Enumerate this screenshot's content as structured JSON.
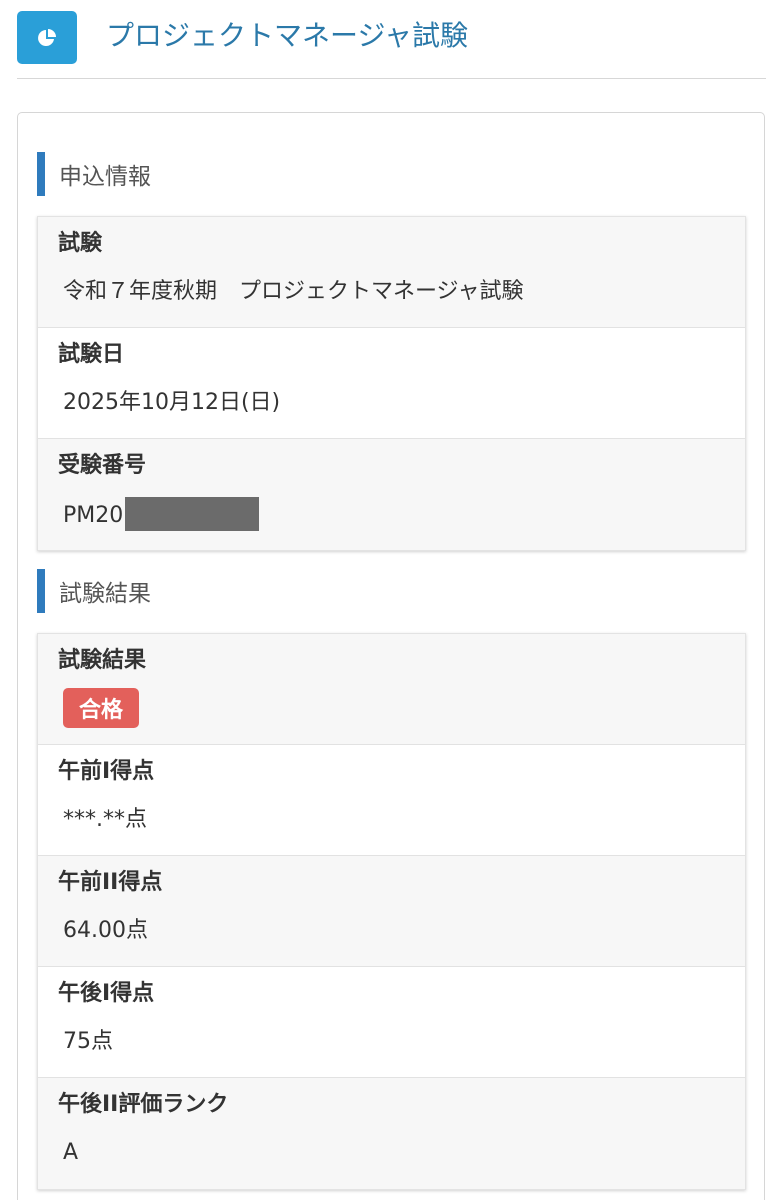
{
  "header": {
    "icon": "pie-chart-icon",
    "accent_color": "#2a9fd8",
    "title": "プロジェクトマネージャ試験"
  },
  "application": {
    "heading": "申込情報",
    "rows": [
      {
        "label": "試験",
        "value": "令和７年度秋期　プロジェクトマネージャ試験"
      },
      {
        "label": "試験日",
        "value": "2025年10月12日(日)"
      },
      {
        "label": "受験番号",
        "value": "PM20"
      }
    ]
  },
  "results": {
    "heading": "試験結果",
    "result_label": "試験結果",
    "result_badge": "合格",
    "badge_color": "#e3605b",
    "rows": [
      {
        "label": "午前I得点",
        "value": "***.**点"
      },
      {
        "label": "午前II得点",
        "value": "64.00点"
      },
      {
        "label": "午後I得点",
        "value": "75点"
      },
      {
        "label": "午後II評価ランク",
        "value": "A"
      }
    ]
  }
}
